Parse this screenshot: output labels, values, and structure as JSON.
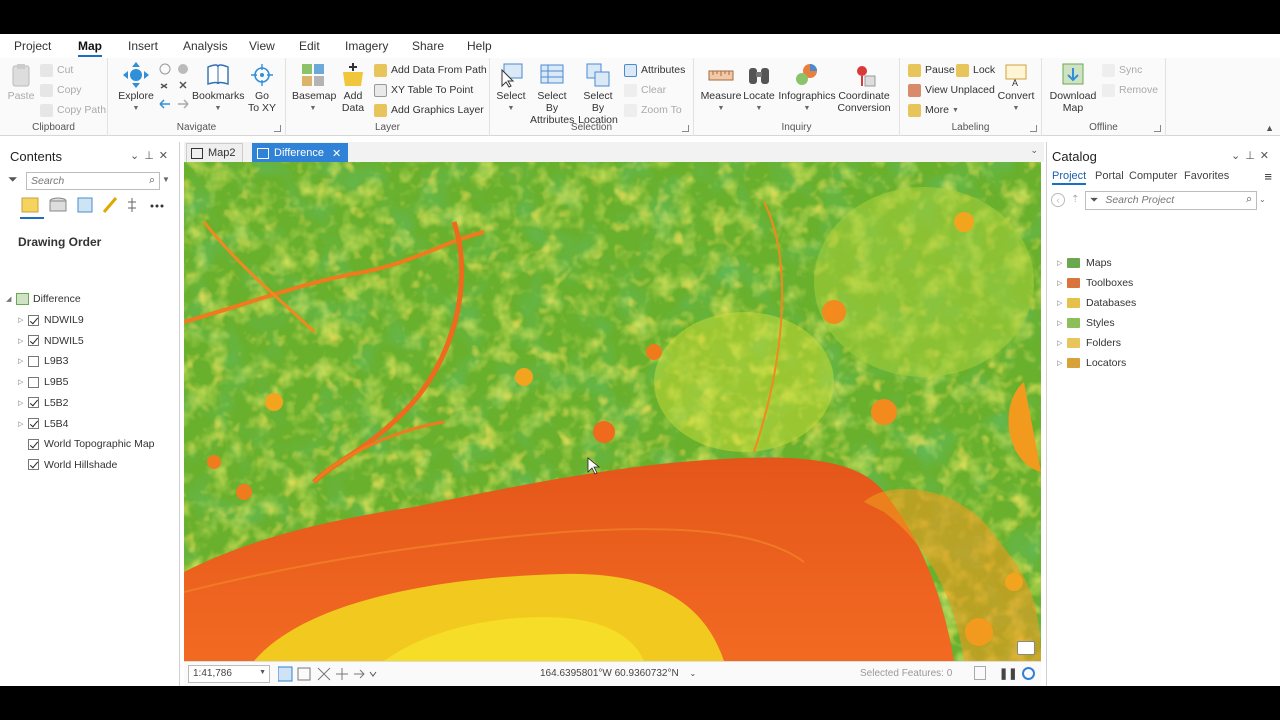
{
  "menu": {
    "tabs": [
      "Project",
      "Map",
      "Insert",
      "Analysis",
      "View",
      "Edit",
      "Imagery",
      "Share",
      "Help"
    ],
    "active": "Map"
  },
  "ribbon": {
    "clipboard": {
      "label": "Clipboard",
      "paste": "Paste",
      "cut": "Cut",
      "copy": "Copy",
      "copy_path": "Copy Path"
    },
    "navigate": {
      "label": "Navigate",
      "explore": "Explore",
      "bookmarks": "Bookmarks",
      "go_to_xy_1": "Go",
      "go_to_xy_2": "To XY"
    },
    "layer": {
      "label": "Layer",
      "basemap": "Basemap",
      "add_data_1": "Add",
      "add_data_2": "Data",
      "add_data_from_path": "Add Data From Path",
      "xy_table_to_point": "XY Table To Point",
      "add_graphics_layer": "Add Graphics Layer"
    },
    "selection": {
      "label": "Selection",
      "select": "Select",
      "select_by_attributes_1": "Select By",
      "select_by_attributes_2": "Attributes",
      "select_by_location_1": "Select By",
      "select_by_location_2": "Location",
      "attributes": "Attributes",
      "clear": "Clear",
      "zoom_to": "Zoom To"
    },
    "inquiry": {
      "label": "Inquiry",
      "measure": "Measure",
      "locate": "Locate",
      "infographics": "Infographics",
      "coordinate_conversion_1": "Coordinate",
      "coordinate_conversion_2": "Conversion"
    },
    "labeling": {
      "label": "Labeling",
      "pause": "Pause",
      "lock": "Lock",
      "view_unplaced": "View Unplaced",
      "more": "More",
      "convert": "Convert"
    },
    "offline": {
      "label": "Offline",
      "download_map_1": "Download",
      "download_map_2": "Map",
      "sync": "Sync",
      "remove": "Remove"
    }
  },
  "contents": {
    "title": "Contents",
    "search_placeholder": "Search",
    "drawing_order": "Drawing Order",
    "map_name": "Difference",
    "layers": [
      {
        "name": "NDWIL9",
        "checked": true,
        "expandable": true
      },
      {
        "name": "NDWIL5",
        "checked": true,
        "expandable": true
      },
      {
        "name": "L9B3",
        "checked": false,
        "expandable": true
      },
      {
        "name": "L9B5",
        "checked": false,
        "expandable": true
      },
      {
        "name": "L5B2",
        "checked": true,
        "expandable": true
      },
      {
        "name": "L5B4",
        "checked": true,
        "expandable": true
      },
      {
        "name": "World Topographic Map",
        "checked": true,
        "expandable": false
      },
      {
        "name": "World Hillshade",
        "checked": true,
        "expandable": false
      }
    ]
  },
  "map_tabs": [
    {
      "label": "Map2",
      "active": false
    },
    {
      "label": "Difference",
      "active": true
    }
  ],
  "status": {
    "scale": "1:41,786",
    "coordinates": "164.6395801°W 60.9360732°N",
    "selected_features": "Selected Features: 0"
  },
  "catalog": {
    "title": "Catalog",
    "tabs": [
      "Project",
      "Portal",
      "Computer",
      "Favorites"
    ],
    "active_tab": "Project",
    "search_placeholder": "Search Project",
    "items": [
      {
        "label": "Maps",
        "color": "#6aa84f"
      },
      {
        "label": "Toolboxes",
        "color": "#d9743c"
      },
      {
        "label": "Databases",
        "color": "#e5c14a"
      },
      {
        "label": "Styles",
        "color": "#8cbf5a"
      },
      {
        "label": "Folders",
        "color": "#e8c55a"
      },
      {
        "label": "Locators",
        "color": "#d8a23a"
      }
    ]
  },
  "colors": {
    "accent": "#1a6fc2",
    "active_tab": "#2f82d6",
    "map_water": "#e8561e",
    "map_land": "#3f9a2a",
    "map_mid": "#e6e02a"
  }
}
